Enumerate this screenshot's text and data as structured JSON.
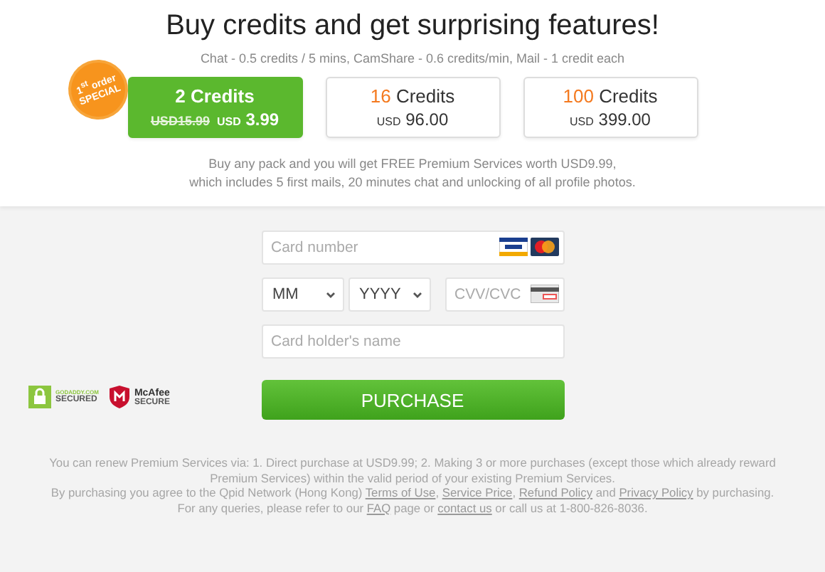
{
  "title": "Buy credits and get surprising features!",
  "subtitle": "Chat - 0.5 credits / 5 mins, CamShare - 0.6 credits/min, Mail - 1 credit each",
  "packs": [
    {
      "amount": "2",
      "unit": "Credits",
      "old_price": "USD15.99",
      "currency": "USD",
      "price": "3.99",
      "selected": true,
      "badge": [
        "1$^{st}$ order",
        "SPECIAL"
      ]
    },
    {
      "amount": "16",
      "unit": "Credits",
      "currency": "USD",
      "price": "96.00",
      "selected": false
    },
    {
      "amount": "100",
      "unit": "Credits",
      "currency": "USD",
      "price": "399.00",
      "selected": false
    }
  ],
  "offer": [
    "Buy any pack and you will get FREE Premium Services worth USD9.99,",
    "which includes 5 first mails, 20 minutes chat and unlocking of all profile photos."
  ],
  "form": {
    "card_number": {
      "placeholder": "Card number"
    },
    "month": {
      "value": "MM"
    },
    "year": {
      "value": "YYYY"
    },
    "cvv": {
      "placeholder": "CVV/CVC"
    },
    "holder": {
      "placeholder": "Card holder's name"
    },
    "button": "PURCHASE"
  },
  "seals": [
    {
      "kind": "lock",
      "top": "GODADDY.COM",
      "bottom": "SECURED"
    },
    {
      "kind": "shield",
      "top": "McAfee",
      "bottom": "SECURE"
    }
  ],
  "footer": [
    [
      {
        "kind": "text",
        "text": "You can renew Premium Services via: 1. Direct purchase at USD9.99; 2. Making 3 or more purchases (except those which already reward Premium Services) within the valid period of your existing Premium Services."
      }
    ],
    [
      {
        "kind": "text",
        "text": "By purchasing you agree to the Qpid Network (Hong Kong) "
      },
      {
        "kind": "link",
        "text": "Terms of Use"
      },
      {
        "kind": "text",
        "text": ", "
      },
      {
        "kind": "link",
        "text": "Service Price"
      },
      {
        "kind": "text",
        "text": ", "
      },
      {
        "kind": "link",
        "text": "Refund Policy"
      },
      {
        "kind": "text",
        "text": " and "
      },
      {
        "kind": "link",
        "text": "Privacy Policy"
      },
      {
        "kind": "text",
        "text": " by purchasing."
      }
    ],
    [
      {
        "kind": "text",
        "text": "For any queries, please refer to our "
      },
      {
        "kind": "link",
        "text": "FAQ"
      },
      {
        "kind": "text",
        "text": " page or "
      },
      {
        "kind": "link",
        "text": "contact us"
      },
      {
        "kind": "text",
        "text": " or call us at 1-800-826-8036."
      }
    ]
  ]
}
